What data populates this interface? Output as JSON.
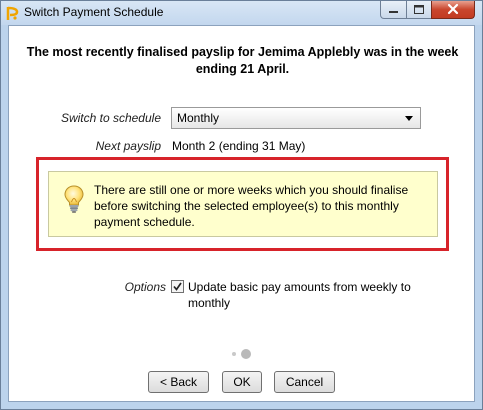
{
  "window": {
    "title": "Switch Payment Schedule",
    "app_icon": "payroll-app-icon",
    "controls": {
      "minimize": "minimize-icon",
      "maximize": "maximize-icon",
      "close": "close-icon"
    }
  },
  "headline": {
    "line1": "The most recently finalised payslip for Jemima Applebly was in the week",
    "line2": "ending 21 April."
  },
  "schedule": {
    "label": "Switch to schedule",
    "value": "Monthly"
  },
  "next_payslip": {
    "label": "Next payslip",
    "value": "Month 2 (ending 31 May)"
  },
  "warning": {
    "icon": "lightbulb-icon",
    "line1": "There are still one or more weeks which you should finalise",
    "line2": "before switching the selected employee(s) to this monthly",
    "line3": "payment schedule."
  },
  "options": {
    "label": "Options",
    "checkbox_checked": true,
    "checkbox_line1": "Update basic pay amounts from weekly to",
    "checkbox_line2": "monthly"
  },
  "pager": {
    "pages": 2,
    "current": 2
  },
  "buttons": {
    "back": "< Back",
    "ok": "OK",
    "cancel": "Cancel"
  },
  "colors": {
    "highlight_border": "#d7232a",
    "warning_background": "#ffffcd"
  }
}
